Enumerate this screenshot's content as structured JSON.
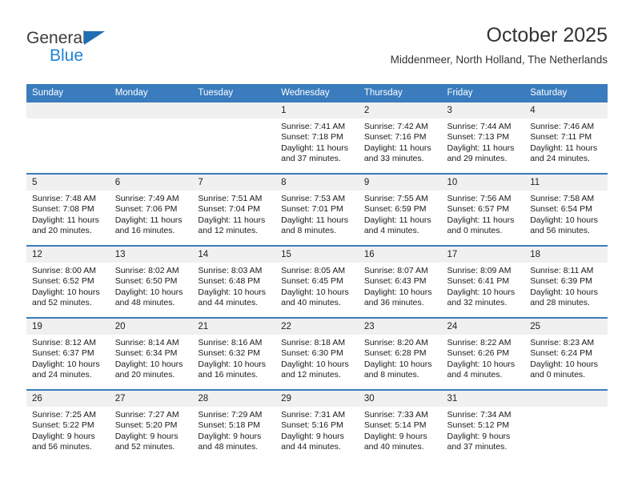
{
  "brand": {
    "line1": "General",
    "line2": "Blue",
    "triangle_icon": "blue-triangle",
    "color_dark": "#3b3b3b",
    "color_blue": "#2083d4"
  },
  "header": {
    "title": "October 2025",
    "subtitle": "Middenmeer, North Holland, The Netherlands"
  },
  "theme": {
    "header_blue": "#3a7cbe",
    "daynum_band": "#f0f0f0",
    "text": "#1a1a1a"
  },
  "weekdays": [
    "Sunday",
    "Monday",
    "Tuesday",
    "Wednesday",
    "Thursday",
    "Friday",
    "Saturday"
  ],
  "labels": {
    "sunrise": "Sunrise:",
    "sunset": "Sunset:",
    "daylight": "Daylight:"
  },
  "weeks": [
    [
      {
        "day": "",
        "sunrise": "",
        "sunset": "",
        "daylight_1": "",
        "daylight_2": ""
      },
      {
        "day": "",
        "sunrise": "",
        "sunset": "",
        "daylight_1": "",
        "daylight_2": ""
      },
      {
        "day": "",
        "sunrise": "",
        "sunset": "",
        "daylight_1": "",
        "daylight_2": ""
      },
      {
        "day": "1",
        "sunrise": "Sunrise: 7:41 AM",
        "sunset": "Sunset: 7:18 PM",
        "daylight_1": "Daylight: 11 hours",
        "daylight_2": "and 37 minutes."
      },
      {
        "day": "2",
        "sunrise": "Sunrise: 7:42 AM",
        "sunset": "Sunset: 7:16 PM",
        "daylight_1": "Daylight: 11 hours",
        "daylight_2": "and 33 minutes."
      },
      {
        "day": "3",
        "sunrise": "Sunrise: 7:44 AM",
        "sunset": "Sunset: 7:13 PM",
        "daylight_1": "Daylight: 11 hours",
        "daylight_2": "and 29 minutes."
      },
      {
        "day": "4",
        "sunrise": "Sunrise: 7:46 AM",
        "sunset": "Sunset: 7:11 PM",
        "daylight_1": "Daylight: 11 hours",
        "daylight_2": "and 24 minutes."
      }
    ],
    [
      {
        "day": "5",
        "sunrise": "Sunrise: 7:48 AM",
        "sunset": "Sunset: 7:08 PM",
        "daylight_1": "Daylight: 11 hours",
        "daylight_2": "and 20 minutes."
      },
      {
        "day": "6",
        "sunrise": "Sunrise: 7:49 AM",
        "sunset": "Sunset: 7:06 PM",
        "daylight_1": "Daylight: 11 hours",
        "daylight_2": "and 16 minutes."
      },
      {
        "day": "7",
        "sunrise": "Sunrise: 7:51 AM",
        "sunset": "Sunset: 7:04 PM",
        "daylight_1": "Daylight: 11 hours",
        "daylight_2": "and 12 minutes."
      },
      {
        "day": "8",
        "sunrise": "Sunrise: 7:53 AM",
        "sunset": "Sunset: 7:01 PM",
        "daylight_1": "Daylight: 11 hours",
        "daylight_2": "and 8 minutes."
      },
      {
        "day": "9",
        "sunrise": "Sunrise: 7:55 AM",
        "sunset": "Sunset: 6:59 PM",
        "daylight_1": "Daylight: 11 hours",
        "daylight_2": "and 4 minutes."
      },
      {
        "day": "10",
        "sunrise": "Sunrise: 7:56 AM",
        "sunset": "Sunset: 6:57 PM",
        "daylight_1": "Daylight: 11 hours",
        "daylight_2": "and 0 minutes."
      },
      {
        "day": "11",
        "sunrise": "Sunrise: 7:58 AM",
        "sunset": "Sunset: 6:54 PM",
        "daylight_1": "Daylight: 10 hours",
        "daylight_2": "and 56 minutes."
      }
    ],
    [
      {
        "day": "12",
        "sunrise": "Sunrise: 8:00 AM",
        "sunset": "Sunset: 6:52 PM",
        "daylight_1": "Daylight: 10 hours",
        "daylight_2": "and 52 minutes."
      },
      {
        "day": "13",
        "sunrise": "Sunrise: 8:02 AM",
        "sunset": "Sunset: 6:50 PM",
        "daylight_1": "Daylight: 10 hours",
        "daylight_2": "and 48 minutes."
      },
      {
        "day": "14",
        "sunrise": "Sunrise: 8:03 AM",
        "sunset": "Sunset: 6:48 PM",
        "daylight_1": "Daylight: 10 hours",
        "daylight_2": "and 44 minutes."
      },
      {
        "day": "15",
        "sunrise": "Sunrise: 8:05 AM",
        "sunset": "Sunset: 6:45 PM",
        "daylight_1": "Daylight: 10 hours",
        "daylight_2": "and 40 minutes."
      },
      {
        "day": "16",
        "sunrise": "Sunrise: 8:07 AM",
        "sunset": "Sunset: 6:43 PM",
        "daylight_1": "Daylight: 10 hours",
        "daylight_2": "and 36 minutes."
      },
      {
        "day": "17",
        "sunrise": "Sunrise: 8:09 AM",
        "sunset": "Sunset: 6:41 PM",
        "daylight_1": "Daylight: 10 hours",
        "daylight_2": "and 32 minutes."
      },
      {
        "day": "18",
        "sunrise": "Sunrise: 8:11 AM",
        "sunset": "Sunset: 6:39 PM",
        "daylight_1": "Daylight: 10 hours",
        "daylight_2": "and 28 minutes."
      }
    ],
    [
      {
        "day": "19",
        "sunrise": "Sunrise: 8:12 AM",
        "sunset": "Sunset: 6:37 PM",
        "daylight_1": "Daylight: 10 hours",
        "daylight_2": "and 24 minutes."
      },
      {
        "day": "20",
        "sunrise": "Sunrise: 8:14 AM",
        "sunset": "Sunset: 6:34 PM",
        "daylight_1": "Daylight: 10 hours",
        "daylight_2": "and 20 minutes."
      },
      {
        "day": "21",
        "sunrise": "Sunrise: 8:16 AM",
        "sunset": "Sunset: 6:32 PM",
        "daylight_1": "Daylight: 10 hours",
        "daylight_2": "and 16 minutes."
      },
      {
        "day": "22",
        "sunrise": "Sunrise: 8:18 AM",
        "sunset": "Sunset: 6:30 PM",
        "daylight_1": "Daylight: 10 hours",
        "daylight_2": "and 12 minutes."
      },
      {
        "day": "23",
        "sunrise": "Sunrise: 8:20 AM",
        "sunset": "Sunset: 6:28 PM",
        "daylight_1": "Daylight: 10 hours",
        "daylight_2": "and 8 minutes."
      },
      {
        "day": "24",
        "sunrise": "Sunrise: 8:22 AM",
        "sunset": "Sunset: 6:26 PM",
        "daylight_1": "Daylight: 10 hours",
        "daylight_2": "and 4 minutes."
      },
      {
        "day": "25",
        "sunrise": "Sunrise: 8:23 AM",
        "sunset": "Sunset: 6:24 PM",
        "daylight_1": "Daylight: 10 hours",
        "daylight_2": "and 0 minutes."
      }
    ],
    [
      {
        "day": "26",
        "sunrise": "Sunrise: 7:25 AM",
        "sunset": "Sunset: 5:22 PM",
        "daylight_1": "Daylight: 9 hours",
        "daylight_2": "and 56 minutes."
      },
      {
        "day": "27",
        "sunrise": "Sunrise: 7:27 AM",
        "sunset": "Sunset: 5:20 PM",
        "daylight_1": "Daylight: 9 hours",
        "daylight_2": "and 52 minutes."
      },
      {
        "day": "28",
        "sunrise": "Sunrise: 7:29 AM",
        "sunset": "Sunset: 5:18 PM",
        "daylight_1": "Daylight: 9 hours",
        "daylight_2": "and 48 minutes."
      },
      {
        "day": "29",
        "sunrise": "Sunrise: 7:31 AM",
        "sunset": "Sunset: 5:16 PM",
        "daylight_1": "Daylight: 9 hours",
        "daylight_2": "and 44 minutes."
      },
      {
        "day": "30",
        "sunrise": "Sunrise: 7:33 AM",
        "sunset": "Sunset: 5:14 PM",
        "daylight_1": "Daylight: 9 hours",
        "daylight_2": "and 40 minutes."
      },
      {
        "day": "31",
        "sunrise": "Sunrise: 7:34 AM",
        "sunset": "Sunset: 5:12 PM",
        "daylight_1": "Daylight: 9 hours",
        "daylight_2": "and 37 minutes."
      },
      {
        "day": "",
        "sunrise": "",
        "sunset": "",
        "daylight_1": "",
        "daylight_2": ""
      }
    ]
  ]
}
